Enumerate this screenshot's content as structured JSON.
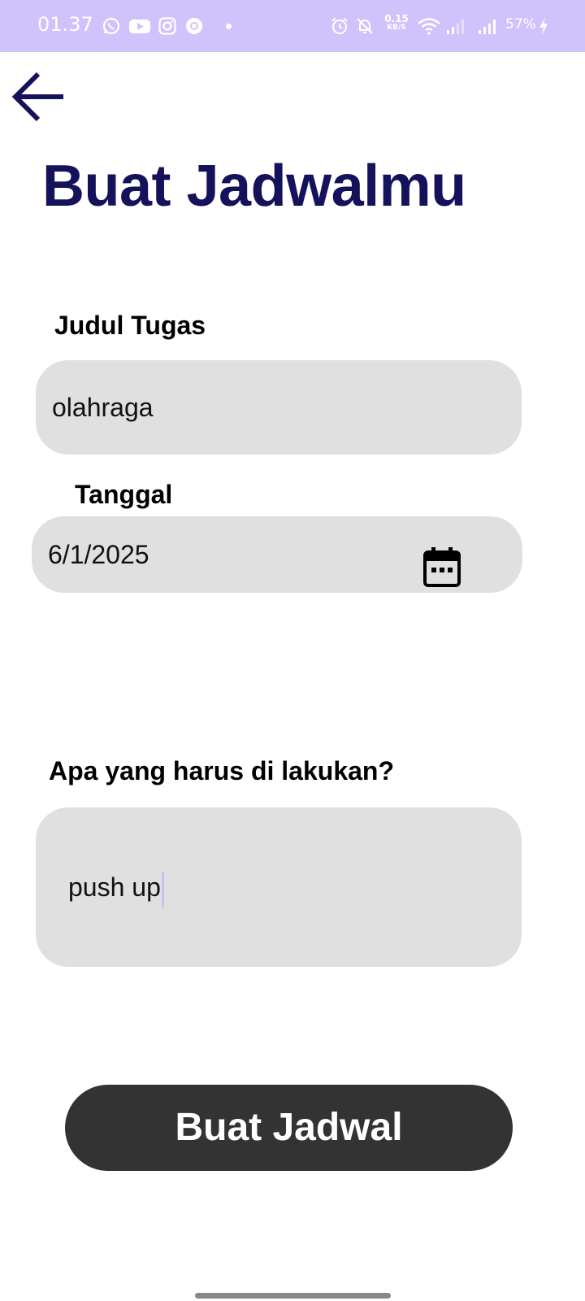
{
  "status_bar": {
    "time": "01.37",
    "speed_value": "0.15",
    "speed_unit": "KB/S",
    "battery": "57%",
    "background_color": "#d0c3fb",
    "icons": [
      "whatsapp-icon",
      "youtube-icon",
      "instagram-icon",
      "chrome-icon",
      "alarm-icon",
      "mute-icon",
      "wifi-icon",
      "signal-icon",
      "signal-icon",
      "charging-icon"
    ]
  },
  "header": {
    "back_icon": "arrow-left-icon",
    "title": "Buat Jadwalmu",
    "title_color": "#15125c"
  },
  "form": {
    "task_title_label": "Judul Tugas",
    "task_title_value": "olahraga",
    "date_label": "Tanggal",
    "date_value": "6/1/2025",
    "date_icon": "calendar-icon",
    "todo_label": "Apa yang harus di lakukan?",
    "todo_value": "push up"
  },
  "actions": {
    "submit_label": "Buat Jadwal",
    "submit_color": "#333333"
  }
}
